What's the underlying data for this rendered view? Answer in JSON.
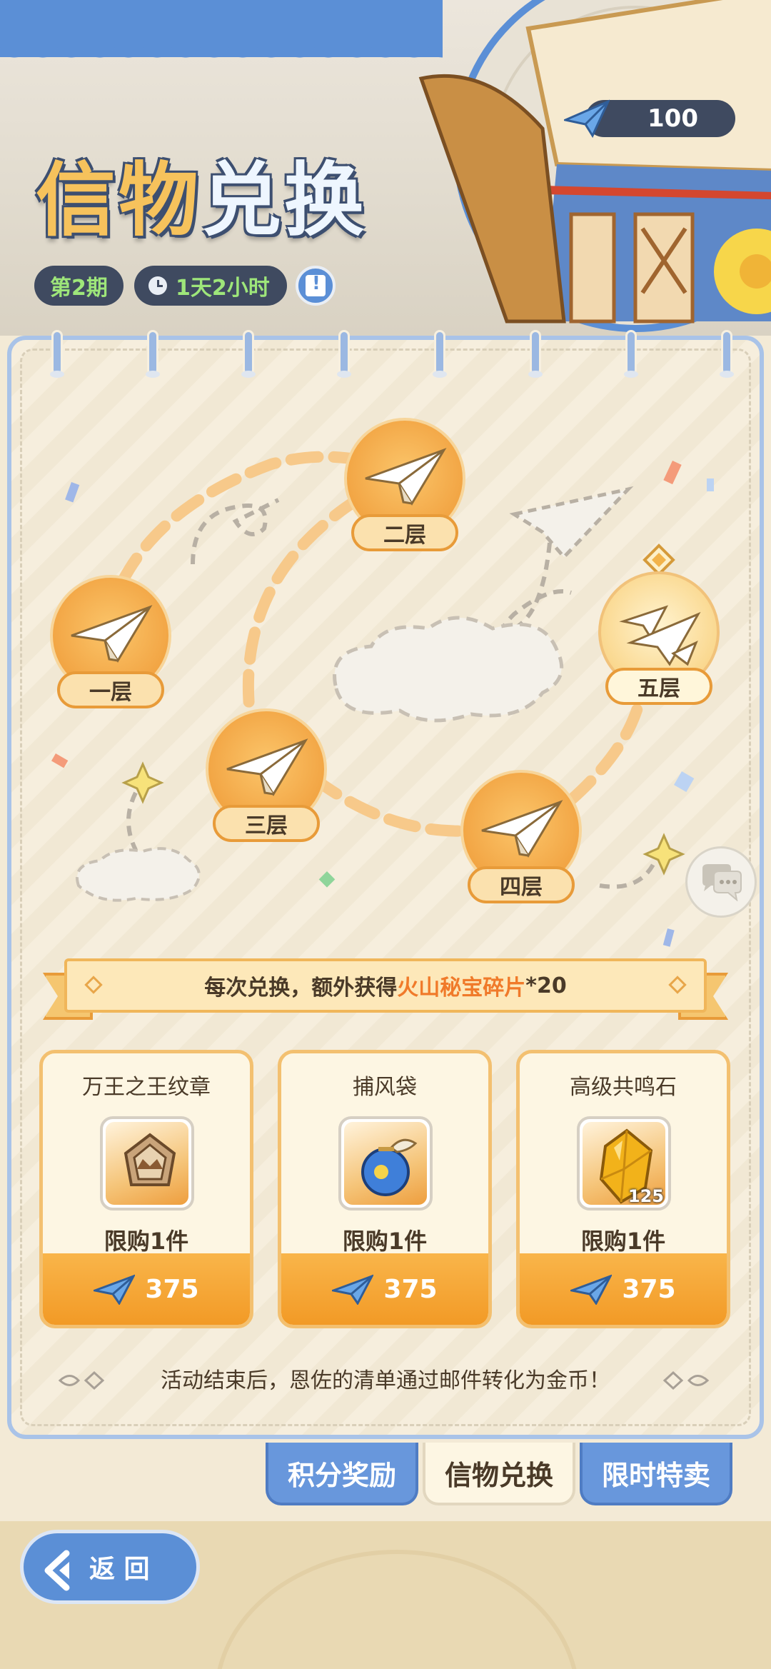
{
  "header": {
    "title_part1": "信物",
    "title_part2": "兑换",
    "points": "100",
    "period": "第2期",
    "timer": "1天2小时"
  },
  "map": {
    "floors": [
      {
        "label": "一层"
      },
      {
        "label": "二层"
      },
      {
        "label": "三层"
      },
      {
        "label": "四层"
      },
      {
        "label": "五层"
      }
    ]
  },
  "ribbon": {
    "prefix": "每次兑换，额外获得",
    "highlight": "火山秘宝碎片",
    "suffix": "*20"
  },
  "shop": {
    "items": [
      {
        "name": "万王之王纹章",
        "limit": "限购1件",
        "price": "375"
      },
      {
        "name": "捕风袋",
        "limit": "限购1件",
        "price": "375"
      },
      {
        "name": "高级共鸣石",
        "limit": "限购1件",
        "price": "375",
        "qty": "125"
      }
    ]
  },
  "footer_note": "活动结束后，恩佐的清单通过邮件转化为金币！",
  "tabs": [
    {
      "label": "积分奖励"
    },
    {
      "label": "信物兑换"
    },
    {
      "label": "限时特卖"
    }
  ],
  "back_label": "返 回",
  "colors": {
    "accent_orange": "#f29a26",
    "accent_blue": "#5b8fd6",
    "highlight_text": "#f07a2a",
    "timer_green": "#9ee67a"
  }
}
